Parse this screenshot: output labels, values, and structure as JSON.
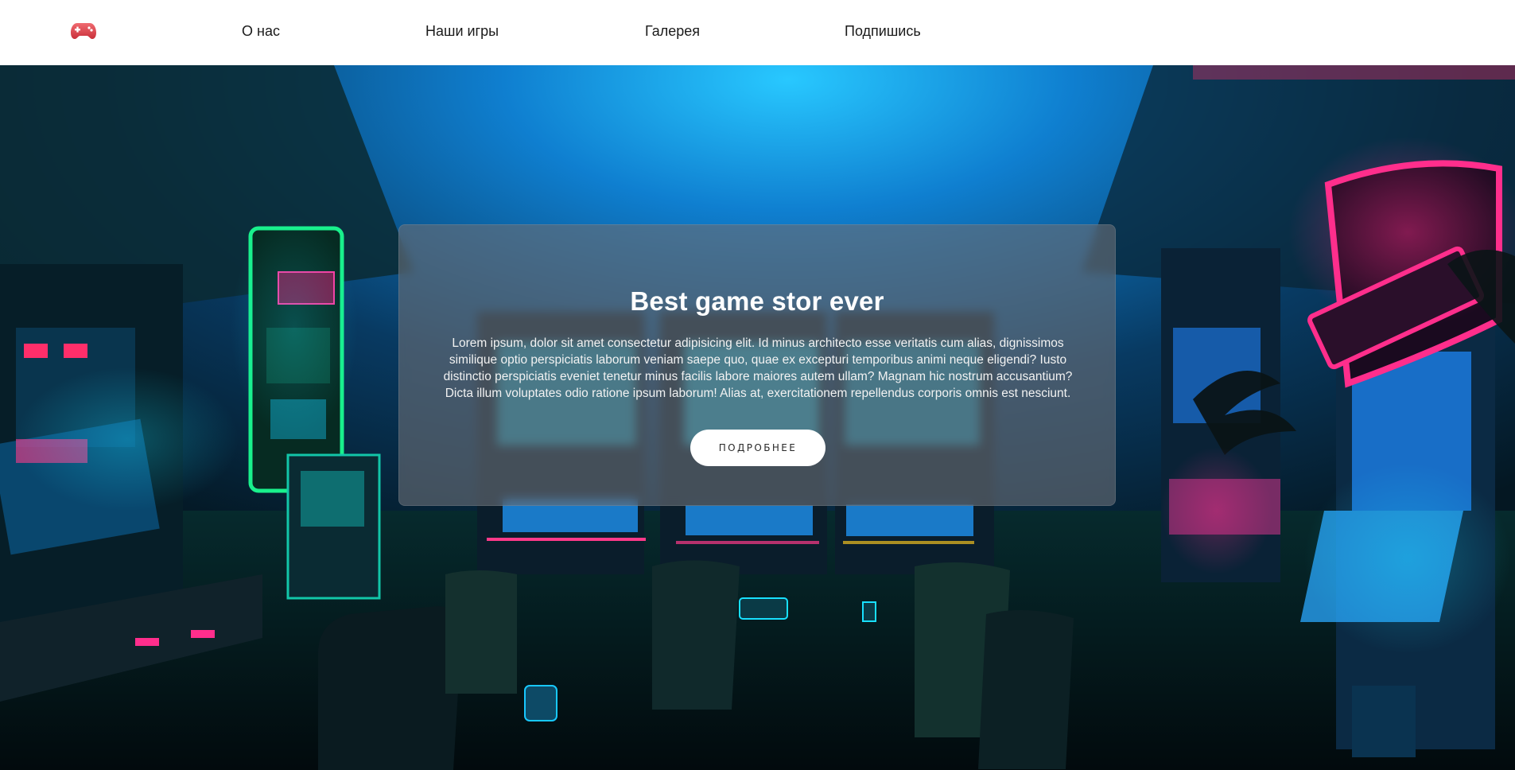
{
  "header": {
    "logo_icon": "gamepad-icon",
    "nav": [
      "О нас",
      "Наши игры",
      "Галерея",
      "Подпишись"
    ]
  },
  "hero": {
    "background": "arcade-room-photo",
    "title": "Best game stor ever",
    "text": "Lorem ipsum, dolor sit amet consectetur adipisicing elit. Id minus architecto esse veritatis cum alias, dignissimos similique optio perspiciatis laborum veniam saepe quo, quae ex excepturi temporibus animi neque eligendi? Iusto distinctio perspiciatis eveniet tenetur minus facilis labore maiores autem ullam? Magnam hic nostrum accusantium? Dicta illum voluptates odio ratione ipsum laborum! Alias at, exercitationem repellendus corporis omnis est nesciunt.",
    "button_label": "ПОДРОБНЕЕ"
  },
  "colors": {
    "accent_pink": "#ff2e8c",
    "accent_cyan": "#18e0ff",
    "logo_red": "#e8474f"
  }
}
